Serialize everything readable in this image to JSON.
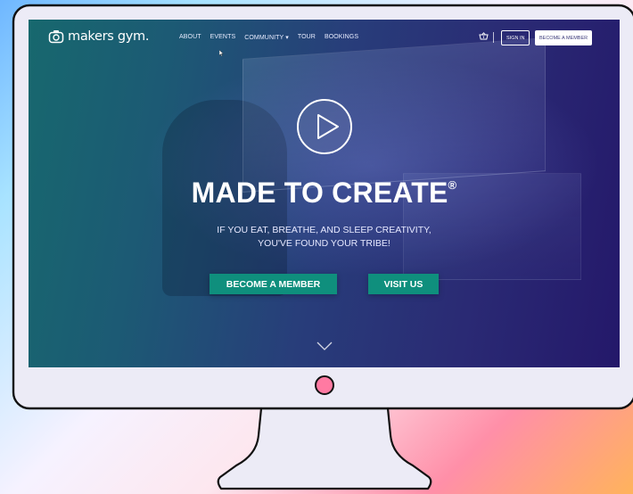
{
  "site": {
    "logo_text": "makers gym."
  },
  "nav": {
    "links": [
      "ABOUT",
      "EVENTS",
      "COMMUNITY ▾",
      "TOUR",
      "BOOKINGS"
    ],
    "sign_in": "SIGN IN",
    "become_member": "BECOME A MEMBER"
  },
  "hero": {
    "headline": "MADE TO CREATE",
    "registered": "®",
    "subline_1": "IF YOU EAT, BREATHE, AND SLEEP CREATIVITY,",
    "subline_2": "YOU'VE FOUND YOUR TRIBE!",
    "cta_member": "BECOME A MEMBER",
    "cta_visit": "VISIT US"
  },
  "colors": {
    "accent": "#0f8f7d",
    "hero_left": "#17686e",
    "hero_right": "#24186a",
    "home_button": "#ff7aa2"
  },
  "icons": [
    "logo-mark-icon",
    "cart-icon",
    "play-icon",
    "chevron-down-icon",
    "cursor-icon"
  ]
}
